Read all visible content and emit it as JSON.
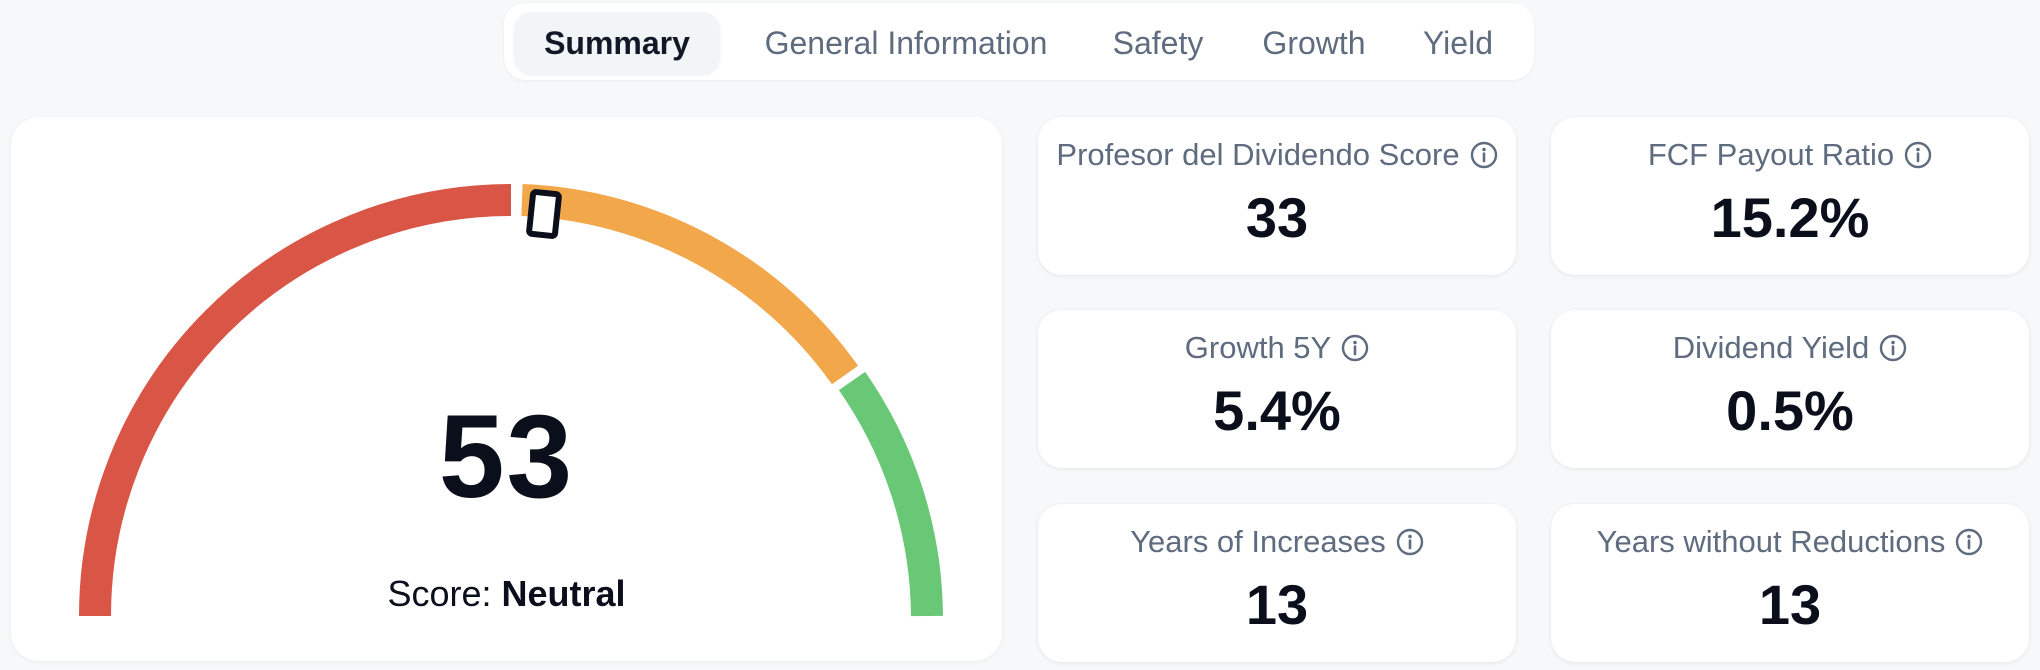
{
  "tabs": [
    {
      "label": "Summary",
      "active": true
    },
    {
      "label": "General Information",
      "active": false
    },
    {
      "label": "Safety",
      "active": false
    },
    {
      "label": "Growth",
      "active": false
    },
    {
      "label": "Yield",
      "active": false
    }
  ],
  "gauge": {
    "score": "53",
    "score_prefix": "Score:",
    "score_rating": "Neutral",
    "segments": [
      {
        "name": "low",
        "color": "#d95546"
      },
      {
        "name": "mid",
        "color": "#f1a74a"
      },
      {
        "name": "high",
        "color": "#69c876"
      }
    ]
  },
  "metrics": {
    "professor_score": {
      "label": "Profesor del Dividendo Score",
      "value": "33"
    },
    "fcf_payout": {
      "label": "FCF Payout Ratio",
      "value": "15.2%"
    },
    "growth_5y": {
      "label": "Growth 5Y",
      "value": "5.4%"
    },
    "dividend_yield": {
      "label": "Dividend Yield",
      "value": "0.5%"
    },
    "years_increases": {
      "label": "Years of Increases",
      "value": "13"
    },
    "years_no_reductions": {
      "label": "Years without Reductions",
      "value": "13"
    }
  },
  "icons": {
    "info": "info-circle-icon"
  }
}
